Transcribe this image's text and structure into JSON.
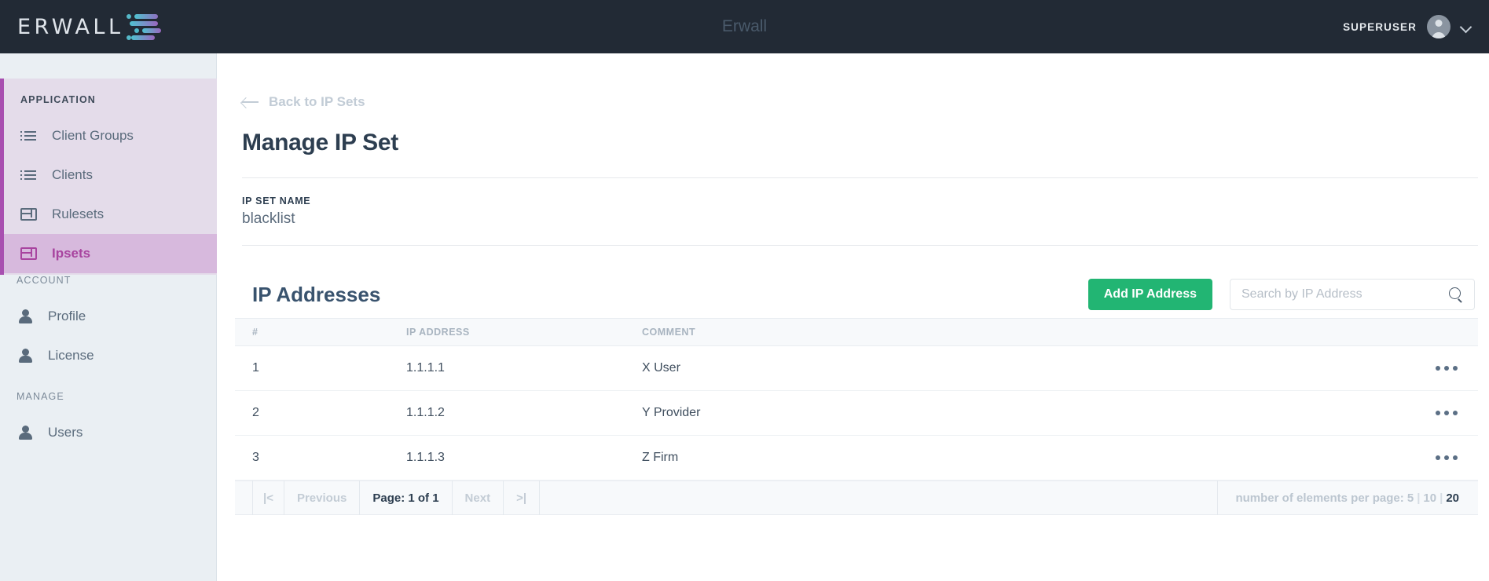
{
  "topbar": {
    "logo_text": "ERWALL",
    "logo_icon": "erwall-gradient-bars-logo",
    "app_title": "Erwall",
    "user_name": "SUPERUSER",
    "avatar_icon": "user-avatar-icon",
    "chevron_icon": "chevron-down-icon"
  },
  "sidebar": {
    "sections": [
      {
        "label": "APPLICATION",
        "items": [
          {
            "label": "Client Groups",
            "icon": "list-icon",
            "active": false
          },
          {
            "label": "Clients",
            "icon": "list-icon",
            "active": false
          },
          {
            "label": "Rulesets",
            "icon": "card-icon",
            "active": false
          },
          {
            "label": "Ipsets",
            "icon": "card-icon",
            "active": true
          }
        ]
      },
      {
        "label": "ACCOUNT",
        "items": [
          {
            "label": "Profile",
            "icon": "person-icon",
            "active": false
          },
          {
            "label": "License",
            "icon": "person-icon",
            "active": false
          }
        ]
      },
      {
        "label": "MANAGE",
        "items": [
          {
            "label": "Users",
            "icon": "person-icon",
            "active": false
          }
        ]
      }
    ],
    "active_accent": "#a8449f",
    "active_bg": "#d7b9dd",
    "application_bg": "#e4dcea",
    "base_bg": "#eaeff3"
  },
  "main": {
    "back_link": "Back to IP Sets",
    "back_icon": "arrow-left-icon",
    "page_title": "Manage IP Set",
    "field_label": "IP SET NAME",
    "field_value": "blacklist"
  },
  "panel": {
    "title": "IP Addresses",
    "add_button": "Add IP Address",
    "add_button_color": "#22b573",
    "search_placeholder": "Search by IP Address",
    "search_value": "",
    "search_icon": "search-icon"
  },
  "table": {
    "columns": [
      "#",
      "IP ADDRESS",
      "COMMENT"
    ],
    "rows": [
      {
        "num": "1",
        "ip": "1.1.1.1",
        "comment": "X User",
        "actions_icon": "more-options-icon"
      },
      {
        "num": "2",
        "ip": "1.1.1.2",
        "comment": "Y Provider",
        "actions_icon": "more-options-icon"
      },
      {
        "num": "3",
        "ip": "1.1.1.3",
        "comment": "Z Firm",
        "actions_icon": "more-options-icon"
      }
    ]
  },
  "pagination": {
    "first_icon": "|<",
    "previous_label": "Previous",
    "page_label": "Page: 1 of 1",
    "next_label": "Next",
    "last_icon": ">|",
    "per_page_label": "number of elements per page:",
    "per_page_options": [
      "5",
      "10",
      "20"
    ],
    "per_page_selected": "20"
  }
}
